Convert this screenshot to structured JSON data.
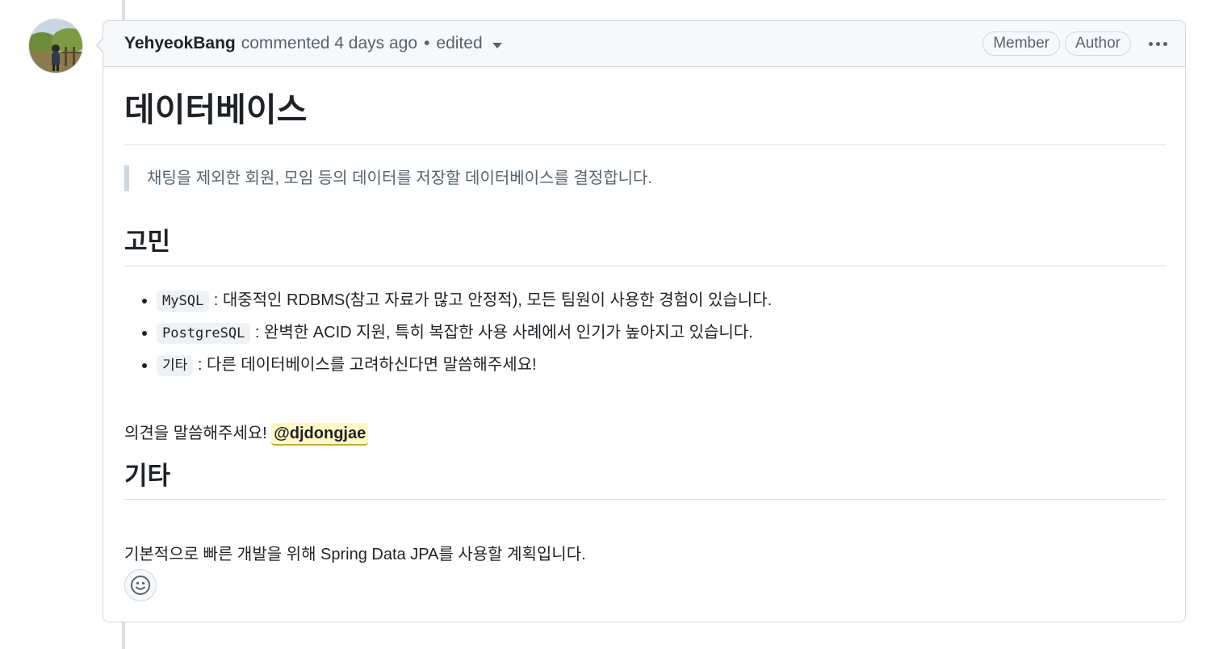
{
  "comment": {
    "author": "YehyeokBang",
    "meta_action": "commented",
    "meta_time": "4 days ago",
    "dot": "•",
    "edited": "edited",
    "badges": [
      "Member",
      "Author"
    ]
  },
  "body": {
    "title": "데이터베이스",
    "quote": "채팅을 제외한 회원, 모임 등의 데이터를 저장할 데이터베이스를 결정합니다.",
    "section1": "고민",
    "options": [
      {
        "code": "MySQL",
        "text": " : 대중적인 RDBMS(참고 자료가 많고 안정적), 모든 팀원이 사용한 경험이 있습니다."
      },
      {
        "code": "PostgreSQL",
        "text": " : 완벽한 ACID 지원, 특히 복잡한 사용 사례에서 인기가 높아지고 있습니다."
      },
      {
        "code": "기타",
        "text": " : 다른 데이터베이스를 고려하신다면 말씀해주세요!"
      }
    ],
    "opinion_text": "의견을 말씀해주세요! ",
    "mention": "@djdongjae",
    "section2": "기타",
    "closing": "기본적으로 빠른 개발을 위해 Spring Data JPA를 사용할 계획입니다."
  },
  "icons": {
    "avatar": "avatar-photo",
    "reaction": "smiley-icon",
    "menu": "kebab-horizontal-icon",
    "dropdown": "triangle-down-icon"
  },
  "colors": {
    "border": "#d0d7de",
    "header_bg": "#f6f8fa",
    "muted_text": "#59636e",
    "mention_bg": "#fff8c5"
  }
}
